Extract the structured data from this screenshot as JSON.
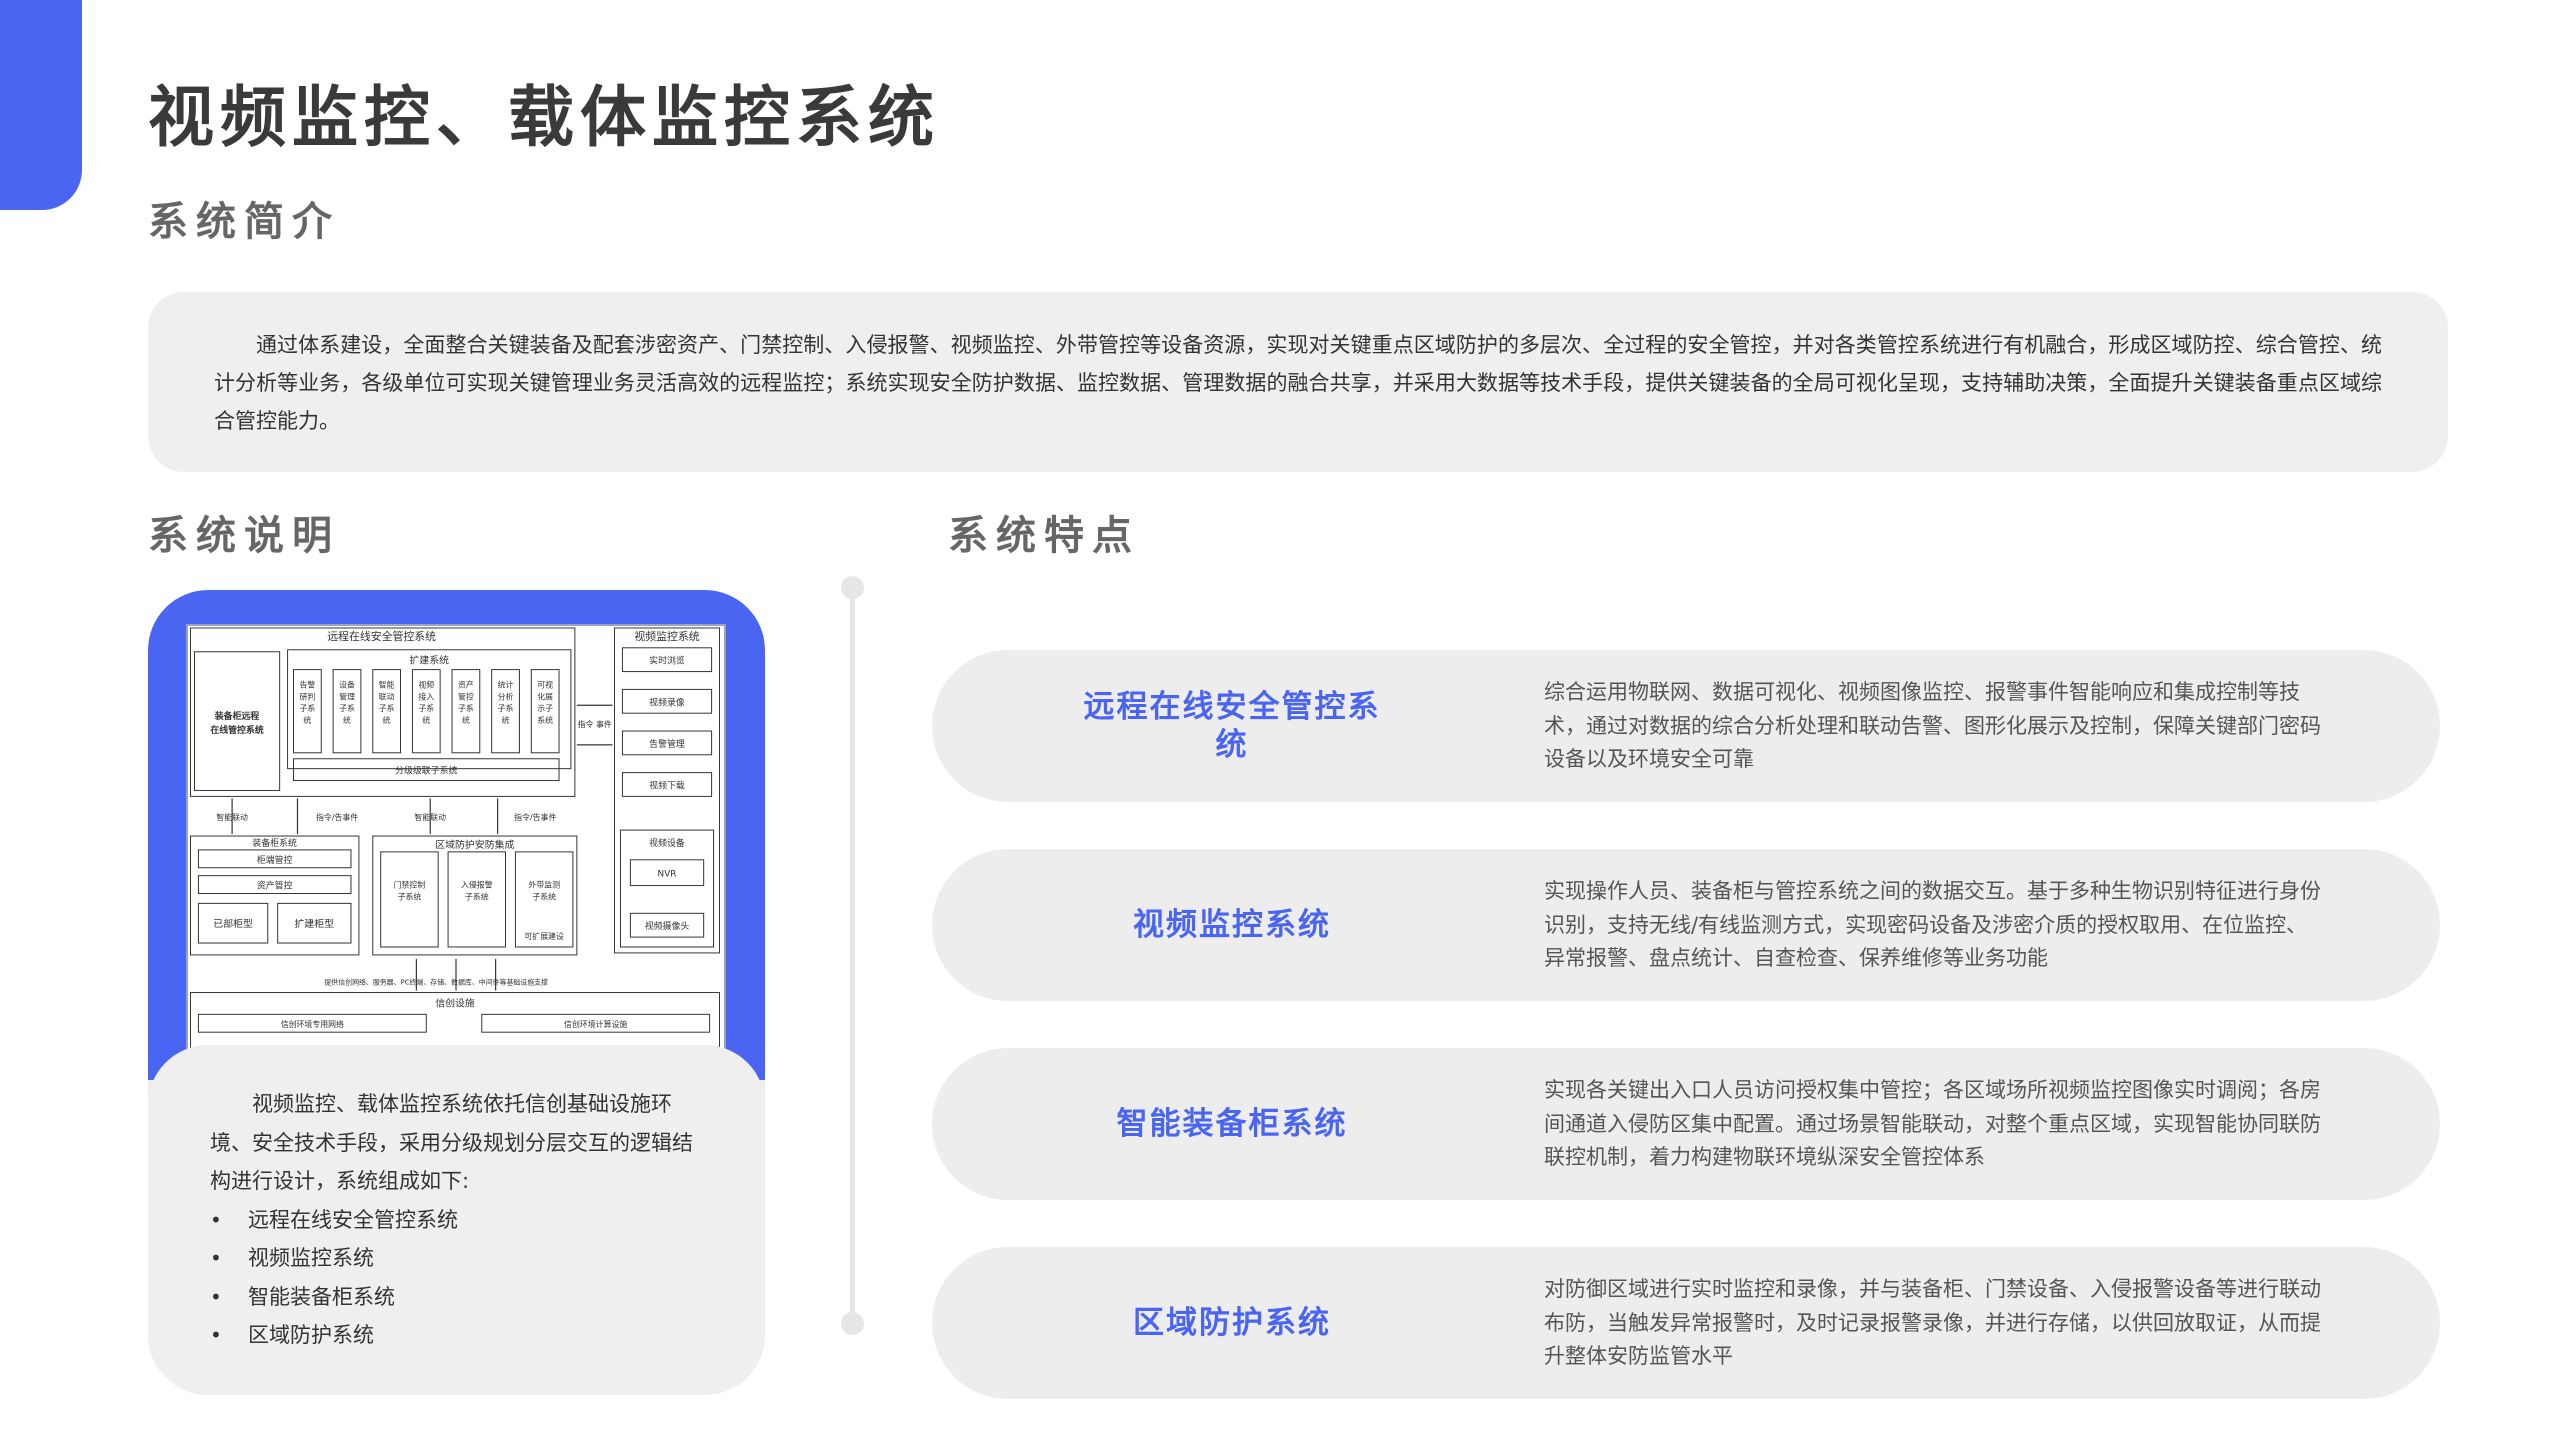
{
  "title": "视频监控、载体监控系统",
  "sections": {
    "intro": "系统简介",
    "description": "系统说明",
    "features": "系统特点"
  },
  "intro_text": "通过体系建设，全面整合关键装备及配套涉密资产、门禁控制、入侵报警、视频监控、外带管控等设备资源，实现对关键重点区域防护的多层次、全过程的安全管控，并对各类管控系统进行有机融合，形成区域防控、综合管控、统计分析等业务，各级单位可实现关键管理业务灵活高效的远程监控；系统实现安全防护数据、监控数据、管理数据的融合共享，并采用大数据等技术手段，提供关键装备的全局可视化呈现，支持辅助决策，全面提升关键装备重点区域综合管控能力。",
  "description_text": "视频监控、载体监控系统依托信创基础设施环境、安全技术手段，采用分级规划分层交互的逻辑结构进行设计，系统组成如下:",
  "components": [
    "远程在线安全管控系统",
    "视频监控系统",
    "智能装备柜系统",
    "区域防护系统"
  ],
  "features": [
    {
      "name": "远程在线安全管控系统",
      "desc": "综合运用物联网、数据可视化、视频图像监控、报警事件智能响应和集成控制等技术，通过对数据的综合分析处理和联动告警、图形化展示及控制，保障关键部门密码设备以及环境安全可靠"
    },
    {
      "name": "视频监控系统",
      "desc": "实现操作人员、装备柜与管控系统之间的数据交互。基于多种生物识别特征进行身份识别，支持无线/有线监测方式，实现密码设备及涉密介质的授权取用、在位监控、异常报警、盘点统计、自查检查、保养维修等业务功能"
    },
    {
      "name": "智能装备柜系统",
      "desc": "实现各关键出入口人员访问授权集中管控；各区域场所视频监控图像实时调阅；各房间通道入侵防区集中配置。通过场景智能联动，对整个重点区域，实现智能协同联防联控机制，着力构建物联环境纵深安全管控体系"
    },
    {
      "name": "区域防护系统",
      "desc": "对防御区域进行实时监控和录像，并与装备柜、门禁设备、入侵报警设备等进行联动布防，当触发异常报警时，及时记录报警录像，并进行存储，以供回放取证，从而提升整体安防监管水平"
    }
  ],
  "diagram": {
    "remote_system": "远程在线安全管控系统",
    "cabinet_remote": "装备柜远程在线管控系统",
    "extension": "扩建系统",
    "subsystems": [
      "告警研判子系统",
      "设备管理子系统",
      "智能联动子系统",
      "视频接入子系统",
      "资产管控子系统",
      "统计分析子系统",
      "可视化展示子系统"
    ],
    "graded_linkage": "分级级联子系统",
    "video_system": "视频监控系统",
    "video_items": [
      "实时浏览",
      "视频录像",
      "告警管理",
      "视频下载"
    ],
    "command_event": "指令 事件",
    "smart_linkage": "智能联动",
    "command_event_2": "指令/告事件",
    "cabinet_system": "装备柜系统",
    "cabinet_items": [
      "柜端管控",
      "资产管控"
    ],
    "cabinet_types": [
      "已部柜型",
      "扩建柜型"
    ],
    "area_integration": "区域防护安防集成",
    "area_items": [
      "门禁控制子系统",
      "入侵报警子系统",
      "外带监测子系统"
    ],
    "expandable": "可扩展建设",
    "video_devices": "视频设备",
    "nvr": "NVR",
    "camera": "视频摄像头",
    "infra_note": "提供信创网络、服务器、PC终端、存储、数据库、中间件等基础设施支撑",
    "infra": "信创设施",
    "infra_items": [
      "信创环境专用网络",
      "信创环境计算设施"
    ]
  }
}
